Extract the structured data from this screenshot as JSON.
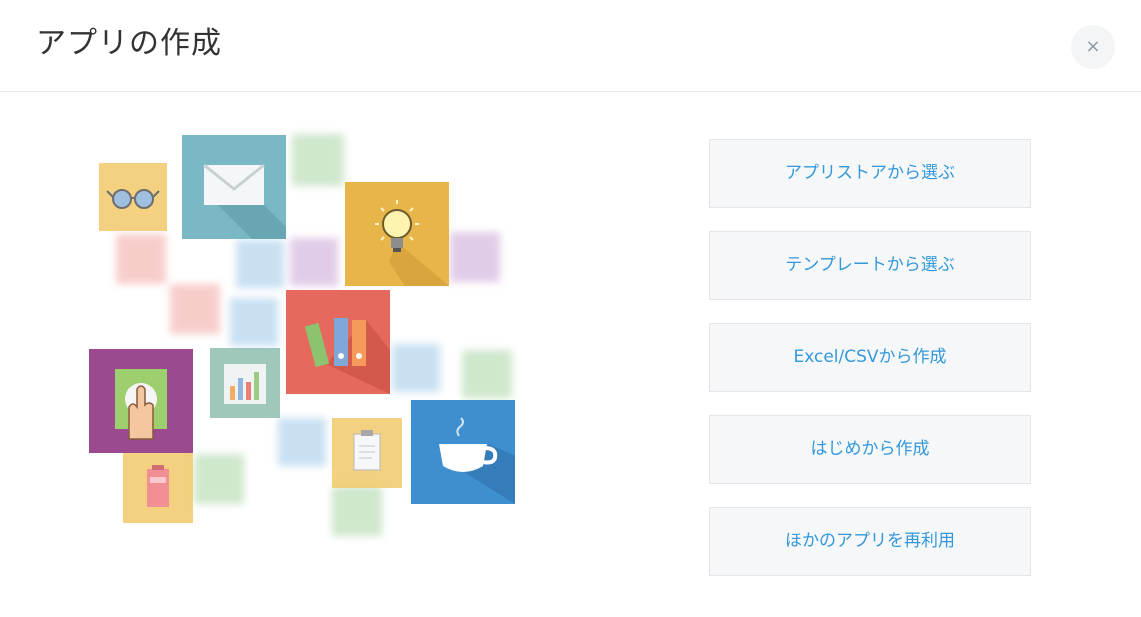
{
  "dialog": {
    "title": "アプリの作成",
    "close_label": "×"
  },
  "options": [
    {
      "label": "アプリストアから選ぶ"
    },
    {
      "label": "テンプレートから選ぶ"
    },
    {
      "label": "Excel/CSVから作成"
    },
    {
      "label": "はじめから作成"
    },
    {
      "label": "ほかのアプリを再利用"
    }
  ],
  "colors": {
    "accent": "#3498db",
    "button_bg": "#f5f7f9",
    "button_border": "#e3e7eb",
    "divider": "#e6e9ec"
  },
  "illustration": {
    "icons": [
      "glasses-icon",
      "envelope-icon",
      "lightbulb-icon",
      "binders-icon",
      "hand-touch-icon",
      "bar-chart-icon",
      "coffee-cup-icon",
      "clipboard-icon",
      "battery-icon"
    ]
  }
}
